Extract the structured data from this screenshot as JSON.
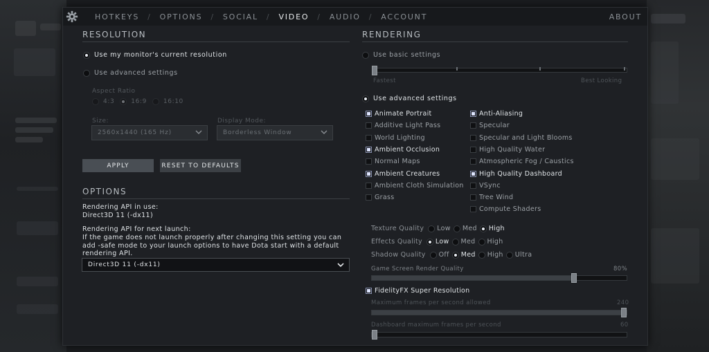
{
  "nav": {
    "tabs": [
      "HOTKEYS",
      "OPTIONS",
      "SOCIAL",
      "VIDEO",
      "AUDIO",
      "ACCOUNT"
    ],
    "separator": "/",
    "active_tab": "VIDEO",
    "about": "ABOUT"
  },
  "resolution": {
    "title": "RESOLUTION",
    "use_current": "Use my monitor's current resolution",
    "use_advanced": "Use advanced settings",
    "aspect_label": "Aspect Ratio",
    "aspect_options": [
      "4:3",
      "16:9",
      "16:10"
    ],
    "size_label": "Size:",
    "size_value": "2560x1440 (165 Hz)",
    "display_mode_label": "Display Mode:",
    "display_mode_value": "Borderless Window",
    "apply_label": "APPLY",
    "reset_label": "RESET TO DEFAULTS"
  },
  "options": {
    "title": "OPTIONS",
    "api_in_use_label": "Rendering API in use:",
    "api_in_use_value": "Direct3D 11 (-dx11)",
    "api_next_label": "Rendering API for next launch:",
    "api_note_line1": "If the game does not launch properly after changing this setting you can",
    "api_note_line2": "add -safe  mode to your launch options to have Dota start with a default",
    "api_note_line3": "rendering API.",
    "api_dropdown_value": "Direct3D 11 (-dx11)"
  },
  "rendering": {
    "title": "RENDERING",
    "use_basic": "Use basic settings",
    "fastest": "Fastest",
    "best_looking": "Best Looking",
    "use_advanced": "Use advanced settings",
    "checkboxes_left": [
      {
        "label": "Animate Portrait",
        "checked": true
      },
      {
        "label": "Additive Light Pass",
        "checked": false
      },
      {
        "label": "World Lighting",
        "checked": false
      },
      {
        "label": "Ambient Occlusion",
        "checked": true
      },
      {
        "label": "Normal Maps",
        "checked": false
      },
      {
        "label": "Ambient Creatures",
        "checked": true
      },
      {
        "label": "Ambient Cloth Simulation",
        "checked": false
      },
      {
        "label": "Grass",
        "checked": false
      }
    ],
    "checkboxes_right": [
      {
        "label": "Anti-Aliasing",
        "checked": true
      },
      {
        "label": "Specular",
        "checked": false
      },
      {
        "label": "Specular and Light Blooms",
        "checked": false
      },
      {
        "label": "High Quality Water",
        "checked": false
      },
      {
        "label": "Atmospheric Fog / Caustics",
        "checked": false
      },
      {
        "label": "High Quality Dashboard",
        "checked": true
      },
      {
        "label": "VSync",
        "checked": false
      },
      {
        "label": "Tree Wind",
        "checked": false
      },
      {
        "label": "Compute Shaders",
        "checked": false
      }
    ],
    "texture_quality": {
      "label": "Texture Quality",
      "options": [
        "Low",
        "Med",
        "High"
      ],
      "selected": "High"
    },
    "effects_quality": {
      "label": "Effects Quality",
      "options": [
        "Low",
        "Med",
        "High"
      ],
      "selected": "Low"
    },
    "shadow_quality": {
      "label": "Shadow Quality",
      "options": [
        "Off",
        "Med",
        "High",
        "Ultra"
      ],
      "selected": "Med"
    },
    "render_quality_label": "Game Screen Render Quality",
    "render_quality_value": "80%",
    "render_quality_fraction": 0.8,
    "fsr_label": "FidelityFX Super Resolution",
    "fsr_checked": true,
    "max_fps_label": "Maximum frames per second allowed",
    "max_fps_value": "240",
    "max_fps_fraction": 1.0,
    "dash_fps_label": "Dashboard maximum frames per second",
    "dash_fps_value": "60",
    "dash_fps_fraction": 0.0
  }
}
